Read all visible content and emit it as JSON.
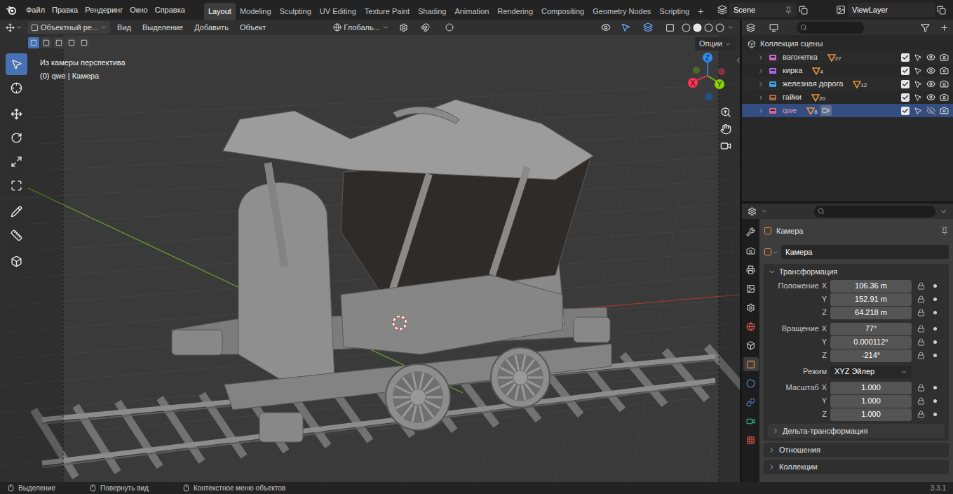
{
  "window": {
    "menu": [
      "Файл",
      "Правка",
      "Рендеринг",
      "Окно",
      "Справка"
    ],
    "workspaces": [
      {
        "label": "Layout",
        "selected": true
      },
      {
        "label": "Modeling",
        "selected": false
      },
      {
        "label": "Sculpting",
        "selected": false
      },
      {
        "label": "UV Editing",
        "selected": false
      },
      {
        "label": "Texture Paint",
        "selected": false
      },
      {
        "label": "Shading",
        "selected": false
      },
      {
        "label": "Animation",
        "selected": false
      },
      {
        "label": "Rendering",
        "selected": false
      },
      {
        "label": "Compositing",
        "selected": false
      },
      {
        "label": "Geometry Nodes",
        "selected": false
      },
      {
        "label": "Scripting",
        "selected": false
      }
    ],
    "add_workspace": "+",
    "scene": "Scene",
    "view_layer": "ViewLayer"
  },
  "viewport": {
    "mode": "Объектный ре...",
    "menus": [
      "Вид",
      "Выделение",
      "Добавить",
      "Объект"
    ],
    "orientation": "Глобаль...",
    "options": "Опции",
    "overlay_lines": [
      "Из камеры перспектива",
      "(0) qwe | Камера"
    ],
    "gizmo": {
      "x": "X",
      "y": "Y",
      "z": "Z"
    },
    "tools": [
      {
        "selected": true
      },
      {
        "selected": false
      },
      {
        "selected": false
      },
      {
        "selected": false
      },
      {
        "selected": false
      },
      {
        "selected": false
      },
      {
        "selected": false
      },
      {
        "selected": false
      },
      {
        "selected": false
      }
    ]
  },
  "outliner": {
    "root": "Коллекция сцены",
    "rows": [
      {
        "name": "вагонетка",
        "count": "27",
        "color": "#d068c6",
        "checked": true,
        "visible": true,
        "selected": false,
        "dimmed": false,
        "camera": false
      },
      {
        "name": "кирка",
        "count": "4",
        "color": "#a66be0",
        "checked": true,
        "visible": true,
        "selected": false,
        "dimmed": false,
        "camera": false
      },
      {
        "name": "железная дорога",
        "count": "12",
        "color": "#3f9fe0",
        "checked": true,
        "visible": true,
        "selected": false,
        "dimmed": false,
        "camera": false
      },
      {
        "name": "гайки",
        "count": "20",
        "color": "#a86a45",
        "checked": true,
        "visible": true,
        "selected": false,
        "dimmed": false,
        "camera": false
      },
      {
        "name": "qwe",
        "count": "6",
        "color": "#d2689a",
        "checked": true,
        "visible": false,
        "selected": true,
        "dimmed": true,
        "camera": true
      }
    ]
  },
  "properties": {
    "tabs": [
      {
        "selected": false,
        "color": "#c8c8c8"
      },
      {
        "selected": false,
        "color": "#c8c8c8"
      },
      {
        "selected": false,
        "color": "#c8c8c8"
      },
      {
        "selected": false,
        "color": "#c8c8c8"
      },
      {
        "selected": false,
        "color": "#c8c8c8"
      },
      {
        "selected": false,
        "color": "#e0574f"
      },
      {
        "selected": false,
        "color": "#c8c8c8"
      },
      {
        "selected": true,
        "color": "#f0953a"
      },
      {
        "selected": false,
        "color": "#5b8fd6"
      },
      {
        "selected": false,
        "color": "#5b8fd6"
      },
      {
        "selected": false,
        "color": "#2fbf9a"
      },
      {
        "selected": false,
        "color": "#d4504a"
      }
    ],
    "breadcrumb": "Камера",
    "name": "Камера",
    "transform": {
      "label": "Трансформация",
      "expanded": true,
      "groups": [
        {
          "label": "Положение",
          "rows": [
            {
              "axis": "X",
              "value": "106.36 m"
            },
            {
              "axis": "Y",
              "value": "152.91 m"
            },
            {
              "axis": "Z",
              "value": "64.218 m"
            }
          ]
        },
        {
          "label": "Вращение",
          "rows": [
            {
              "axis": "X",
              "value": "77°"
            },
            {
              "axis": "Y",
              "value": "0.000112°"
            },
            {
              "axis": "Z",
              "value": "-214°"
            }
          ]
        }
      ],
      "mode": {
        "label": "Режим",
        "value": "XYZ Эйлер"
      },
      "scale": {
        "label": "Масштаб",
        "rows": [
          {
            "axis": "X",
            "value": "1.000"
          },
          {
            "axis": "Y",
            "value": "1.000"
          },
          {
            "axis": "Z",
            "value": "1.000"
          }
        ]
      },
      "subpanel": {
        "label": "Дельта-трансформация",
        "expanded": false
      }
    },
    "panels": [
      {
        "label": "Отношения",
        "expanded": false
      },
      {
        "label": "Коллекции",
        "expanded": false
      }
    ]
  },
  "status_bar": {
    "items": [
      "Выделение",
      "Повернуть вид",
      "Контекстное меню объектов"
    ],
    "version": "3.3.1"
  }
}
